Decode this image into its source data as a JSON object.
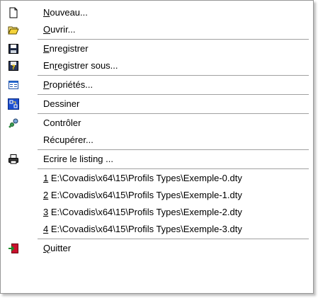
{
  "menu": {
    "items": [
      {
        "id": "nouveau",
        "label": "Nouveau...",
        "access": "N",
        "icon": "new-document-icon"
      },
      {
        "id": "ouvrir",
        "label": "Ouvrir...",
        "access": "O",
        "icon": "open-folder-icon"
      },
      {
        "sep": true
      },
      {
        "id": "enregistrer",
        "label": "Enregistrer",
        "access": "E",
        "icon": "floppy-disk-icon"
      },
      {
        "id": "enregistrer-sous",
        "label": "Enregistrer sous...",
        "access": "r",
        "accessIndex": 2,
        "icon": "save-as-icon"
      },
      {
        "sep": true
      },
      {
        "id": "proprietes",
        "label": "Propriétés...",
        "access": "P",
        "icon": "properties-icon"
      },
      {
        "sep": true
      },
      {
        "id": "dessiner",
        "label": "Dessiner",
        "access": "",
        "icon": "draw-icon"
      },
      {
        "sep": true
      },
      {
        "id": "controler",
        "label": "Contrôler",
        "access": "",
        "icon": "check-gears-icon"
      },
      {
        "id": "recuperer",
        "label": "Récupérer...",
        "access": "",
        "icon": ""
      },
      {
        "sep": true
      },
      {
        "id": "ecrire-listing",
        "label": "Ecrire le listing ...",
        "access": "",
        "icon": "printer-icon"
      },
      {
        "sep": true
      },
      {
        "id": "recent-1",
        "label": "1 E:\\Covadis\\x64\\15\\Profils Types\\Exemple-0.dty",
        "access": "1",
        "icon": ""
      },
      {
        "id": "recent-2",
        "label": "2 E:\\Covadis\\x64\\15\\Profils Types\\Exemple-1.dty",
        "access": "2",
        "icon": ""
      },
      {
        "id": "recent-3",
        "label": "3 E:\\Covadis\\x64\\15\\Profils Types\\Exemple-2.dty",
        "access": "3",
        "icon": ""
      },
      {
        "id": "recent-4",
        "label": "4 E:\\Covadis\\x64\\15\\Profils Types\\Exemple-3.dty",
        "access": "4",
        "icon": ""
      },
      {
        "sep": true
      },
      {
        "id": "quitter",
        "label": "Quitter",
        "access": "Q",
        "icon": "exit-door-icon"
      }
    ]
  }
}
